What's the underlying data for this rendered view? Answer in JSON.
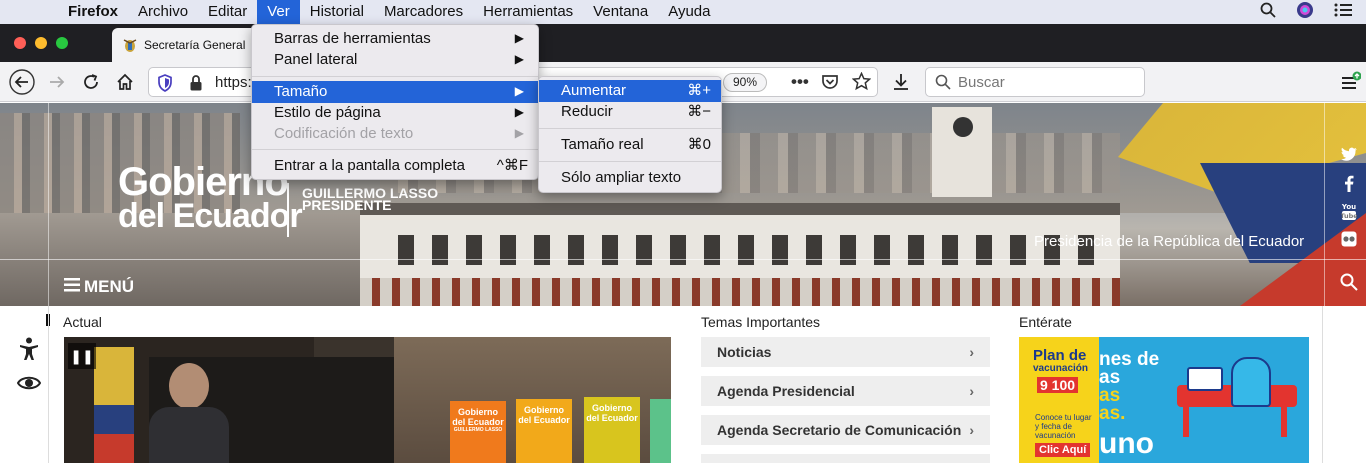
{
  "menubar": {
    "app_name": "Firefox",
    "items": [
      "Archivo",
      "Editar",
      "Ver",
      "Historial",
      "Marcadores",
      "Herramientas",
      "Ventana",
      "Ayuda"
    ],
    "active": "Ver"
  },
  "tab": {
    "title": "Secretaría General"
  },
  "toolbar": {
    "url_text": "https:",
    "zoom": "90%",
    "search_placeholder": "Buscar"
  },
  "view_menu": {
    "items": [
      {
        "label": "Barras de herramientas",
        "submenu": "▶"
      },
      {
        "label": "Panel lateral",
        "submenu": "▶"
      },
      {
        "label": "Tamaño",
        "submenu": "▶"
      },
      {
        "label": "Estilo de página",
        "submenu": "▶"
      },
      {
        "label": "Codificación de texto",
        "submenu": "▶"
      },
      {
        "label": "Entrar a la pantalla completa",
        "shortcut": "^⌘F"
      }
    ]
  },
  "zoom_menu": {
    "items": [
      {
        "label": "Aumentar",
        "shortcut": "⌘+"
      },
      {
        "label": "Reducir",
        "shortcut": "⌘−"
      },
      {
        "label": "Tamaño real",
        "shortcut": "⌘0"
      },
      {
        "label": "Sólo ampliar texto"
      }
    ]
  },
  "hero": {
    "logo_line1": "Gobierno",
    "logo_line2": "del Ecuador",
    "logo_sub1": "GUILLERMO LASSO",
    "logo_sub2": "PRESIDENTE",
    "tagline": "Presidencia de la República del Ecuador",
    "menu_label": "MENÚ"
  },
  "sections": {
    "actual": "Actual",
    "temas": "Temas Importantes",
    "enterate": "Entérate"
  },
  "topics": [
    {
      "label": "Noticias",
      "chevron": "›"
    },
    {
      "label": "Agenda Presidencial",
      "chevron": "›"
    },
    {
      "label": "Agenda Secretario de Comunicación",
      "chevron": "›"
    }
  ],
  "video": {
    "pause": "❚❚",
    "panel_line1": "Gobierno",
    "panel_line2": "del Ecuador",
    "panel_sub": "GUILLERMO LASSO"
  },
  "banner": {
    "plan_line1": "Plan de",
    "plan_line2": "vacunación",
    "plan_numbers": "9 100",
    "plan_text1": "Conoce tu lugar",
    "plan_text2": "y fecha de",
    "plan_text3": "vacunación",
    "plan_cta": "Clic Aquí",
    "headline1": "nes de",
    "headline2": "as",
    "headline3": "as",
    "headline4": "as.",
    "headline5": "uno"
  },
  "social": [
    "twitter-icon",
    "facebook-icon",
    "youtube-icon",
    "flickr-icon"
  ],
  "colors": {
    "menu_highlight": "#2364d8",
    "tab_bar": "#1f1f23",
    "menubar": "#e4e7f2"
  }
}
